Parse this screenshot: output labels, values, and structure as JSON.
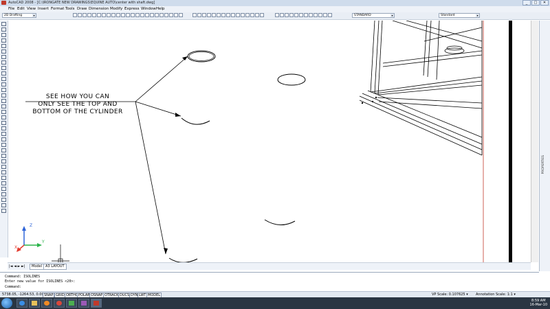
{
  "window": {
    "title": "AutoCAD 2008 - [C:\\IRONGATE NEW DRAWINGS\\EQUINE AUTO\\center with shaft.dwg]",
    "app_icon": "autocad-icon",
    "buttons": [
      "_",
      "□",
      "✕"
    ]
  },
  "menu": {
    "items": [
      "File",
      "Edit",
      "View",
      "Insert",
      "Format",
      "Tools",
      "Draw",
      "Dimension",
      "Modify",
      "Express",
      "Window",
      "Help"
    ],
    "search_placeholder": "Type a question for help"
  },
  "toolbar": {
    "workspace": "2D Drafting",
    "text_style": "STANDARD",
    "dim_style": "Standard"
  },
  "drawing": {
    "annotation_lines": [
      "SEE HOW YOU CAN",
      "ONLY SEE THE TOP AND",
      "BOTTOM OF THE CYLINDER"
    ],
    "ucs": {
      "x_label": "X",
      "y_label": "Y",
      "z_label": "Z"
    }
  },
  "right_panel": {
    "label": "PROPERTIES"
  },
  "layout_tabs": {
    "nav": "|◄ ◄ ► ►|",
    "tabs": [
      "Model",
      "A3 LAYOUT"
    ]
  },
  "command_line": {
    "lines": [
      "Command: ISOLINES",
      "Enter new value for ISOLINES <20>:",
      "Command:"
    ]
  },
  "status_bar": {
    "coords": "5738.05, -1264.53, 0.00",
    "toggles": [
      "SNAP",
      "GRID",
      "ORTHO",
      "POLAR",
      "OSNAP",
      "OTRACK",
      "DUCS",
      "DYN",
      "LWT",
      "MODEL"
    ],
    "vp_scale": "VP Scale: 0.107625 ▾",
    "annotation_scale": "Annotation Scale: 1:1 ▾"
  },
  "taskbar": {
    "time": "8:59 AM",
    "date": "16-Mar-10"
  },
  "colors": {
    "menu_bg": "#eef2f8",
    "title_bg": "#cfdcec",
    "taskbar_bg": "#2a3542",
    "ucs_x": "#e33b2f",
    "ucs_y": "#2bb34a",
    "ucs_z": "#2e64d8"
  }
}
